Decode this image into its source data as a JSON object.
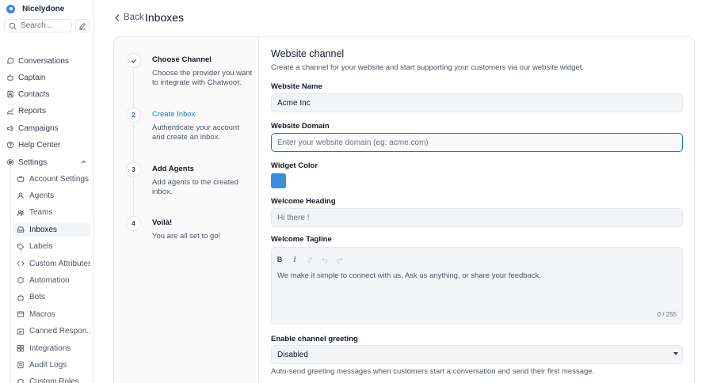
{
  "brand": {
    "name": "Nicelydone"
  },
  "search": {
    "placeholder": "Search..."
  },
  "nav": {
    "items": [
      {
        "label": "Conversations",
        "icon": "chat-icon"
      },
      {
        "label": "Captain",
        "icon": "bot-icon"
      },
      {
        "label": "Contacts",
        "icon": "contacts-icon"
      },
      {
        "label": "Reports",
        "icon": "chart-icon"
      },
      {
        "label": "Campaigns",
        "icon": "megaphone-icon"
      },
      {
        "label": "Help Center",
        "icon": "help-icon"
      },
      {
        "label": "Settings",
        "icon": "gear-icon"
      }
    ],
    "settings_items": [
      {
        "label": "Account Settings",
        "icon": "briefcase-icon"
      },
      {
        "label": "Agents",
        "icon": "agents-icon"
      },
      {
        "label": "Teams",
        "icon": "teams-icon"
      },
      {
        "label": "Inboxes",
        "icon": "inbox-icon",
        "active": true
      },
      {
        "label": "Labels",
        "icon": "tag-icon"
      },
      {
        "label": "Custom Attributes",
        "icon": "code-icon"
      },
      {
        "label": "Automation",
        "icon": "automation-icon"
      },
      {
        "label": "Bots",
        "icon": "bot-icon"
      },
      {
        "label": "Macros",
        "icon": "macro-icon"
      },
      {
        "label": "Canned Respon...",
        "icon": "canned-icon"
      },
      {
        "label": "Integrations",
        "icon": "integrations-icon"
      },
      {
        "label": "Audit Logs",
        "icon": "audit-icon"
      },
      {
        "label": "Custom Roles",
        "icon": "shield-icon"
      }
    ]
  },
  "header": {
    "back_label": "Back",
    "title": "Inboxes"
  },
  "steps": [
    {
      "number": "",
      "title": "Choose Channel",
      "description": "Choose the provider you want to integrate with Chatwoot.",
      "state": "done"
    },
    {
      "number": "2",
      "title": "Create Inbox",
      "description": "Authenticate your account and create an inbox.",
      "state": "active"
    },
    {
      "number": "3",
      "title": "Add Agents",
      "description": "Add agents to the created inbox.",
      "state": "pending"
    },
    {
      "number": "4",
      "title": "Voilà!",
      "description": "You are all set to go!",
      "state": "pending"
    }
  ],
  "form": {
    "title": "Website channel",
    "description": "Create a channel for your website and start supporting your customers via our website widget.",
    "website_name": {
      "label": "Website Name",
      "value": "Acme Inc"
    },
    "website_domain": {
      "label": "Website Domain",
      "placeholder": "Enter your website domain (eg: acme.com)"
    },
    "widget_color": {
      "label": "Widget Color",
      "value": "#3b8fd9"
    },
    "welcome_heading": {
      "label": "Welcome Heading",
      "placeholder": "Hi there !"
    },
    "welcome_tagline": {
      "label": "Welcome Tagline",
      "value": "We make it simple to connect with us. Ask us anything, or share your feedback.",
      "counter": "0 / 255"
    },
    "greeting": {
      "label": "Enable channel greeting",
      "selected": "Disabled",
      "hint": "Auto-send greeting messages when customers start a conversation and send their first message."
    }
  },
  "colors": {
    "accent": "#1f6fd1",
    "widget": "#3b8fd9"
  }
}
